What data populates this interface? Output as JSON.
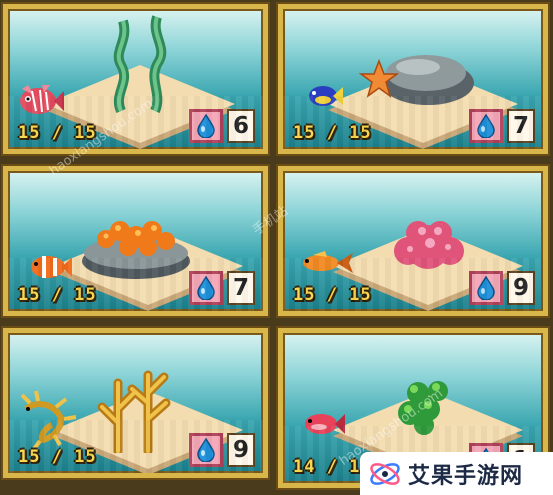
{
  "cards": [
    {
      "name": "seaweed",
      "count": "15 / 15",
      "cost": "6"
    },
    {
      "name": "starfish-rock",
      "count": "15 / 15",
      "cost": "7"
    },
    {
      "name": "orange-coral-rock",
      "count": "15 / 15",
      "cost": "7"
    },
    {
      "name": "pink-coral",
      "count": "15 / 15",
      "cost": "9"
    },
    {
      "name": "yellow-branch-coral",
      "count": "15 / 15",
      "cost": "9"
    },
    {
      "name": "green-coral",
      "count": "14 / 1",
      "cost": "1 1"
    }
  ],
  "icons": {
    "water": "water-drop-icon",
    "brand_logo": "brand-logo-icon"
  },
  "watermark": {
    "url": "haoxiangshou.com",
    "cn": "手机站"
  },
  "brand": {
    "label": "艾果手游网"
  },
  "colors": {
    "frame": "#d9b64a",
    "count_text": "#f7d64a",
    "water_bg": "#f4a6b6",
    "water_drop": "#1e8fd8"
  }
}
